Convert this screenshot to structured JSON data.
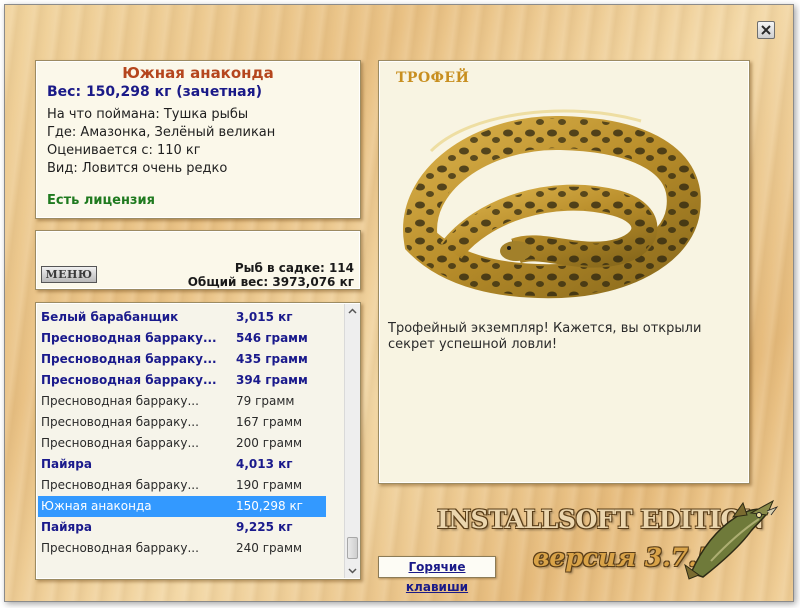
{
  "info": {
    "fish_name": "Южная анаконда",
    "weight": "Вес: 150,298 кг (зачетная)",
    "lines": [
      "На что поймана: Тушка рыбы",
      "Где: Амазонка, Зелёный великан",
      "Оценивается с: 110 кг",
      "Вид: Ловится очень редко"
    ],
    "license": "Есть лицензия"
  },
  "stats": {
    "menu_label": "МЕНЮ",
    "fish_count": "Рыб в садке: 114",
    "total_weight": "Общий вес: 3973,076 кг"
  },
  "catch_list": [
    {
      "name": "Белый барабанщик",
      "weight": "3,015 кг",
      "style": "bold"
    },
    {
      "name": "Пресноводная барраку...",
      "weight": "546 грамм",
      "style": "bold"
    },
    {
      "name": "Пресноводная барраку...",
      "weight": "435 грамм",
      "style": "bold"
    },
    {
      "name": "Пресноводная барраку...",
      "weight": "394 грамм",
      "style": "bold"
    },
    {
      "name": "Пресноводная барраку...",
      "weight": "79 грамм",
      "style": "normal"
    },
    {
      "name": "Пресноводная барраку...",
      "weight": "167 грамм",
      "style": "normal"
    },
    {
      "name": "Пресноводная барраку...",
      "weight": "200 грамм",
      "style": "normal"
    },
    {
      "name": "Пайяра",
      "weight": "4,013 кг",
      "style": "bold"
    },
    {
      "name": "Пресноводная барраку...",
      "weight": "190 грамм",
      "style": "normal"
    },
    {
      "name": "Южная анаконда",
      "weight": "150,298 кг",
      "style": "selected"
    },
    {
      "name": "Пайяра",
      "weight": "9,225 кг",
      "style": "bold"
    },
    {
      "name": "Пресноводная барраку...",
      "weight": "240 грамм",
      "style": "normal"
    }
  ],
  "trophy": {
    "title": "ТРОФЕЙ",
    "description": "Трофейный экземпляр! Кажется, вы открыли секрет успешной ловли!"
  },
  "hotkeys_label": "Горячие клавиши",
  "brand": {
    "edition": "INSTALLSOFT EDITION",
    "version": "версия 3.7.5"
  },
  "icons": {
    "close": "close-icon",
    "scroll_up": "chevron-up-icon",
    "scroll_down": "chevron-down-icon",
    "trophy_image": "anaconda-image",
    "logo": "pike-fish-icon"
  },
  "colors": {
    "fish_name": "#b5461e",
    "weight": "#1a1a88",
    "license": "#1f7a1f",
    "selected_row": "#3399ff",
    "trophy_title": "#c88f20"
  }
}
